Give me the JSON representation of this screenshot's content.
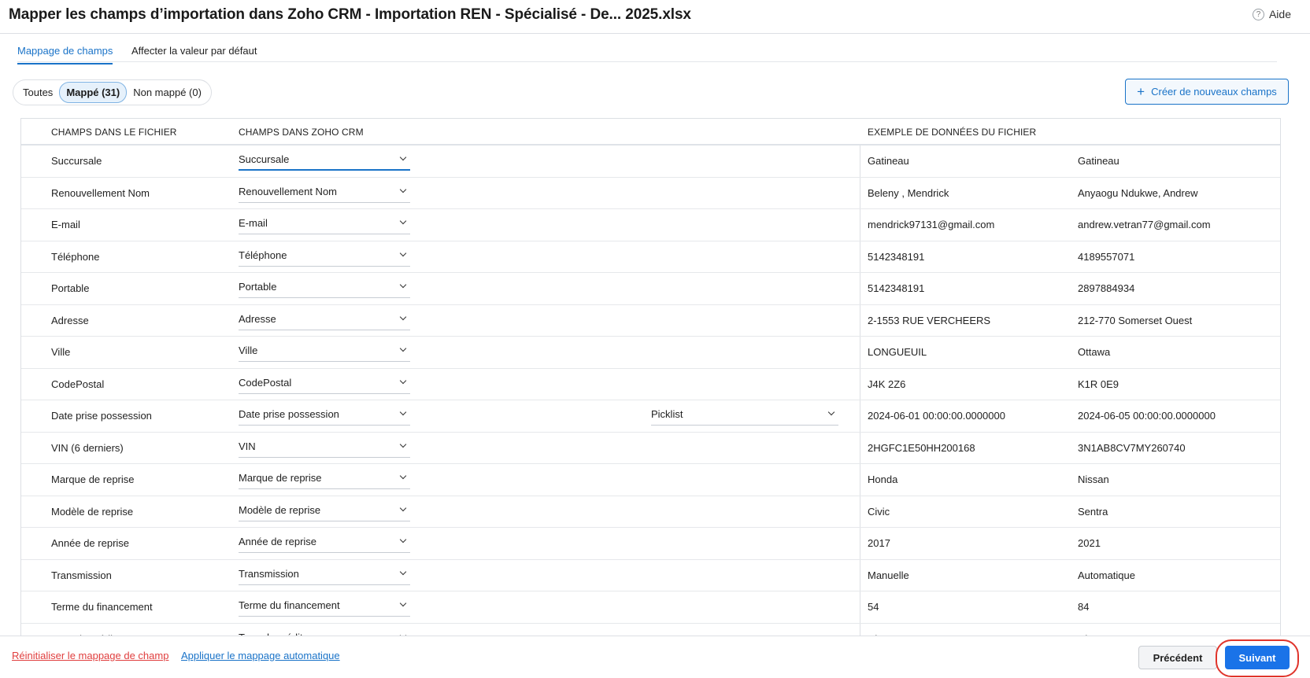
{
  "header": {
    "title": "Mapper les champs d’importation dans Zoho CRM - Importation REN - Spécialisé - De... 2025.xlsx",
    "help_label": "Aide",
    "help_icon": "?"
  },
  "tabs": [
    {
      "label": "Mappage de champs",
      "active": true
    },
    {
      "label": "Affecter la valeur par défaut",
      "active": false
    }
  ],
  "filters": [
    {
      "label": "Toutes",
      "active": false
    },
    {
      "label": "Mappé (31)",
      "active": true
    },
    {
      "label": "Non mappé (0)",
      "active": false
    }
  ],
  "create_button": {
    "icon": "+",
    "label": "Créer de nouveaux champs"
  },
  "table": {
    "headers": {
      "file_fields": "CHAMPS DANS LE FICHIER",
      "crm_fields": "CHAMPS DANS ZOHO CRM",
      "sample": "EXEMPLE DE DONNÉES DU FICHIER"
    },
    "rows": [
      {
        "file_field": "Succursale",
        "crm_field": "Succursale",
        "extra": "",
        "sample1": "Gatineau",
        "sample2": "Gatineau",
        "focused": true
      },
      {
        "file_field": "Renouvellement Nom",
        "crm_field": "Renouvellement Nom",
        "extra": "",
        "sample1": "Beleny , Mendrick",
        "sample2": "Anyaogu Ndukwe, Andrew"
      },
      {
        "file_field": "E-mail",
        "crm_field": "E-mail",
        "extra": "",
        "sample1": "mendrick97131@gmail.com",
        "sample2": "andrew.vetran77@gmail.com"
      },
      {
        "file_field": "Téléphone",
        "crm_field": "Téléphone",
        "extra": "",
        "sample1": "5142348191",
        "sample2": "4189557071"
      },
      {
        "file_field": "Portable",
        "crm_field": "Portable",
        "extra": "",
        "sample1": "5142348191",
        "sample2": "2897884934"
      },
      {
        "file_field": "Adresse",
        "crm_field": "Adresse",
        "extra": "",
        "sample1": "2-1553 RUE VERCHEERS",
        "sample2": "212-770 Somerset Ouest"
      },
      {
        "file_field": "Ville",
        "crm_field": "Ville",
        "extra": "",
        "sample1": "LONGUEUIL",
        "sample2": "Ottawa"
      },
      {
        "file_field": "CodePostal",
        "crm_field": "CodePostal",
        "extra": "",
        "sample1": "J4K 2Z6",
        "sample2": "K1R 0E9"
      },
      {
        "file_field": "Date prise possession",
        "crm_field": "Date prise possession",
        "extra": "Picklist",
        "sample1": "2024-06-01 00:00:00.0000000",
        "sample2": "2024-06-05 00:00:00.0000000"
      },
      {
        "file_field": "VIN (6 derniers)",
        "crm_field": "VIN",
        "extra": "",
        "sample1": "2HGFC1E50HH200168",
        "sample2": "3N1AB8CV7MY260740"
      },
      {
        "file_field": "Marque de reprise",
        "crm_field": "Marque de reprise",
        "extra": "",
        "sample1": "Honda",
        "sample2": "Nissan"
      },
      {
        "file_field": "Modèle de reprise",
        "crm_field": "Modèle de reprise",
        "extra": "",
        "sample1": "Civic",
        "sample2": "Sentra"
      },
      {
        "file_field": "Année de reprise",
        "crm_field": "Année de reprise",
        "extra": "",
        "sample1": "2017",
        "sample2": "2021"
      },
      {
        "file_field": "Transmission",
        "crm_field": "Transmission",
        "extra": "",
        "sample1": "Manuelle",
        "sample2": "Automatique"
      },
      {
        "file_field": "Terme du financement",
        "crm_field": "Terme du financement",
        "extra": "",
        "sample1": "54",
        "sample2": "84"
      },
      {
        "file_field": "Type de crédit",
        "crm_field": "Type de crédit",
        "extra": "",
        "sample1": "Classe C",
        "sample2": "Classe C"
      }
    ]
  },
  "footer": {
    "reset_link": "Réinitialiser le mappage de champ",
    "auto_link": "Appliquer le mappage automatique",
    "prev_label": "Précédent",
    "next_label": "Suivant"
  },
  "colors": {
    "accent": "#1a73c8",
    "primary_button": "#1a73e8",
    "danger": "#e03e3e",
    "highlight_ring": "#e0342b"
  }
}
